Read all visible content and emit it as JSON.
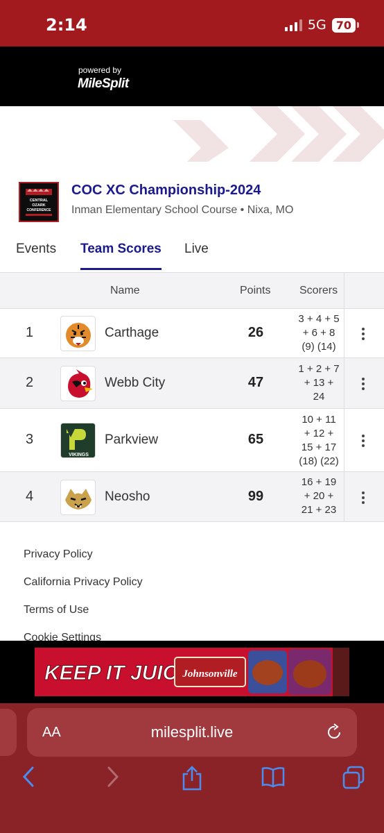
{
  "status": {
    "time": "2:14",
    "network": "5G",
    "battery": "70"
  },
  "powered": {
    "by_label": "powered by",
    "brand": "MileSplit"
  },
  "meet": {
    "logo_lines": [
      "CENTRAL",
      "OZARK",
      "CONFERENCE"
    ],
    "title": "COC XC Championship-2024",
    "subtitle": "Inman Elementary School Course • Nixa, MO"
  },
  "tabs": [
    {
      "label": "Events",
      "active": false
    },
    {
      "label": "Team Scores",
      "active": true
    },
    {
      "label": "Live",
      "active": false
    }
  ],
  "table": {
    "headers": {
      "name": "Name",
      "points": "Points",
      "scorers": "Scorers"
    },
    "rows": [
      {
        "rank": "1",
        "team": "Carthage",
        "points": "26",
        "scorers": [
          "3 + 4 + 5",
          "+ 6 + 8",
          "(9) (14)"
        ],
        "logo": "tiger-logo"
      },
      {
        "rank": "2",
        "team": "Webb City",
        "points": "47",
        "scorers": [
          "1 + 2 + 7",
          "+ 13 +",
          "24"
        ],
        "logo": "cardinal-logo"
      },
      {
        "rank": "3",
        "team": "Parkview",
        "points": "65",
        "scorers": [
          "10 + 11",
          "+ 12 +",
          "15 + 17",
          "(18) (22)"
        ],
        "logo": "vikings-logo",
        "logo_text": "VIKINGS"
      },
      {
        "rank": "4",
        "team": "Neosho",
        "points": "99",
        "scorers": [
          "16 + 19",
          "+ 20 +",
          "21 + 23"
        ],
        "logo": "wildcat-logo"
      }
    ]
  },
  "footer": {
    "links": [
      "Privacy Policy",
      "California Privacy Policy",
      "Terms of Use",
      "Cookie Settings"
    ]
  },
  "ad": {
    "headline": "KEEP IT JUICY",
    "brand": "Johnsonville"
  },
  "browser": {
    "aa_label": "AA",
    "url": "milesplit.live"
  },
  "colors": {
    "status_bg": "#a31a1e",
    "accent": "#1a1a8c",
    "safari_bg": "#8a2328"
  }
}
